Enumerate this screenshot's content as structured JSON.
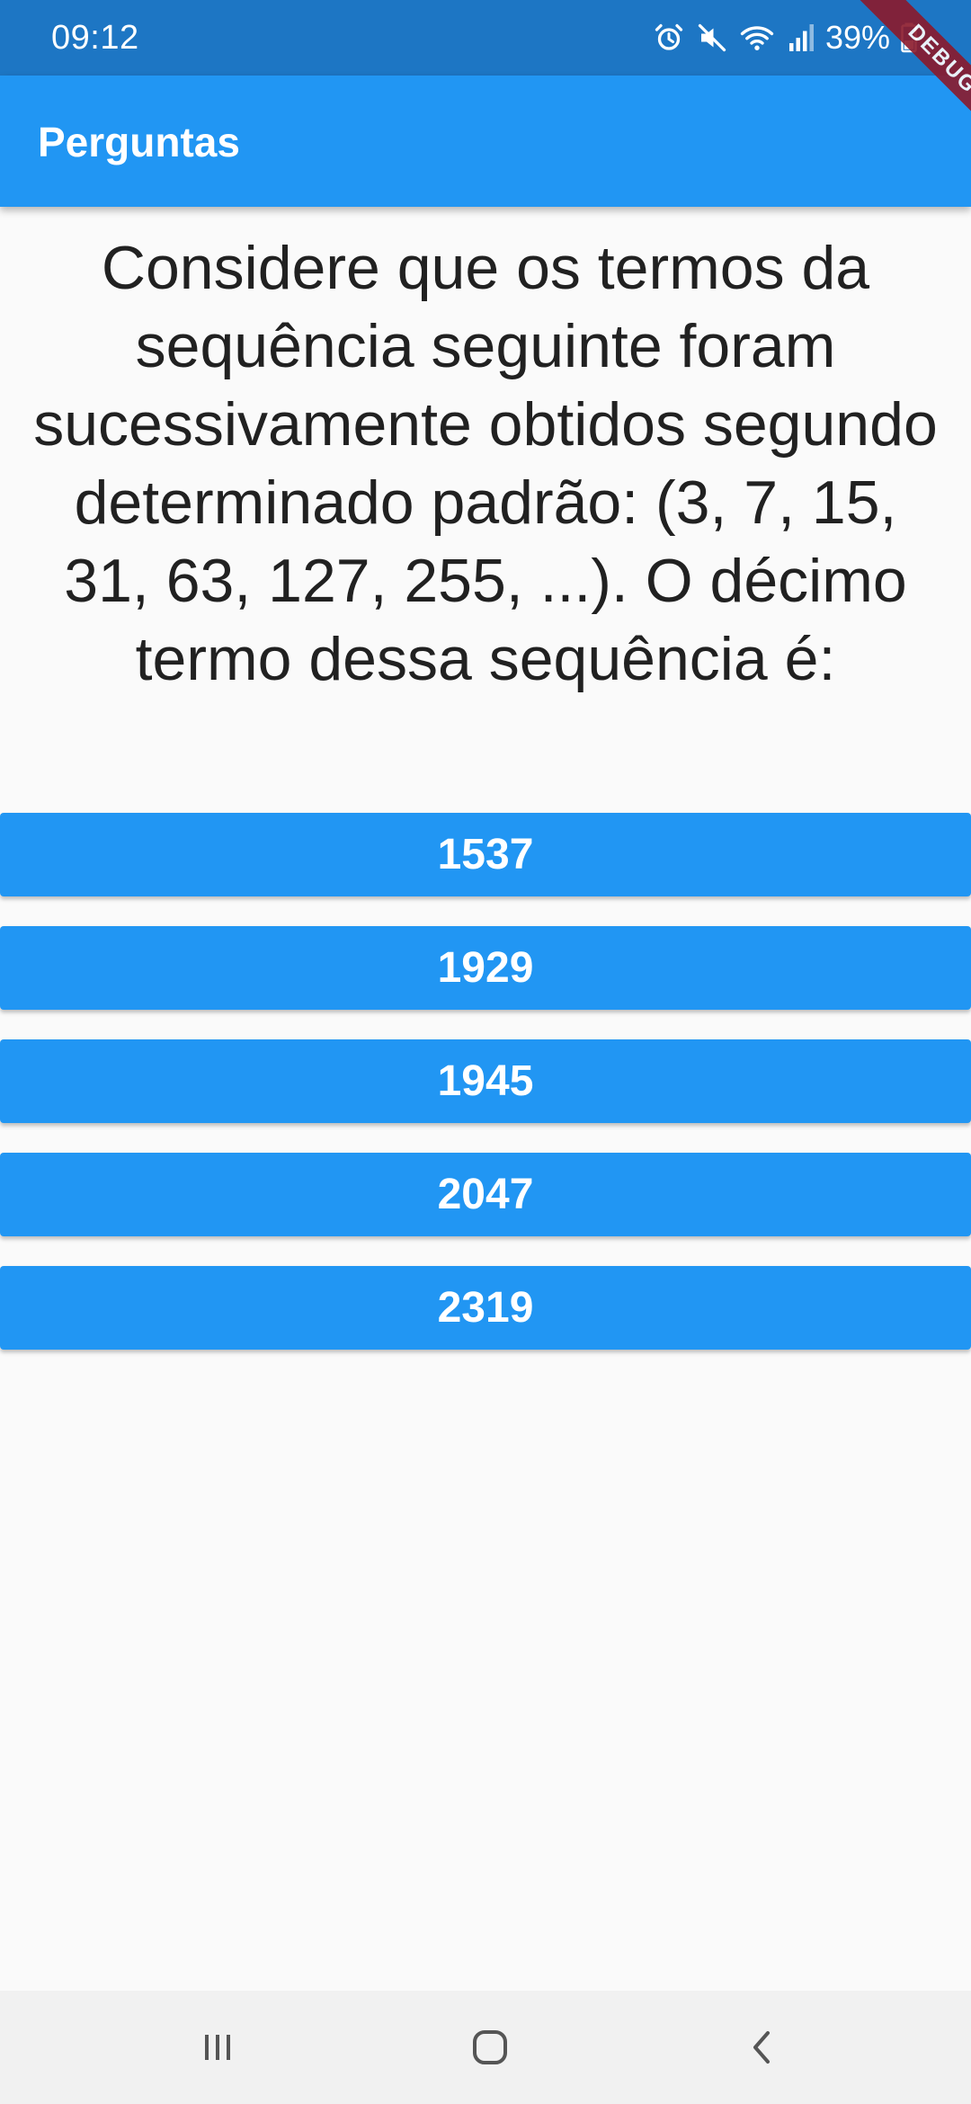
{
  "status_bar": {
    "time": "09:12",
    "battery": "39%",
    "icons": [
      "alarm-icon",
      "mute-icon",
      "wifi-icon",
      "signal-icon",
      "battery-icon"
    ]
  },
  "app_bar": {
    "title": "Perguntas",
    "debug_banner": "DEBUG"
  },
  "question": {
    "text": "Considere que os termos da sequência seguinte foram sucessivamente obtidos segundo determinado padrão: (3,  7,  15,  31,  63,  127,  255,  ...). O décimo termo dessa sequência é:"
  },
  "answers": [
    {
      "label": "1537"
    },
    {
      "label": "1929"
    },
    {
      "label": "1945"
    },
    {
      "label": "2047"
    },
    {
      "label": "2319"
    }
  ],
  "nav_bar": {
    "icons": [
      "recents-icon",
      "home-icon",
      "back-icon"
    ]
  },
  "colors": {
    "status_bar": "#1d76c4",
    "primary": "#2196f3",
    "background": "#fafafa",
    "text": "#212121",
    "debug_ribbon": "#8b1a2c"
  }
}
